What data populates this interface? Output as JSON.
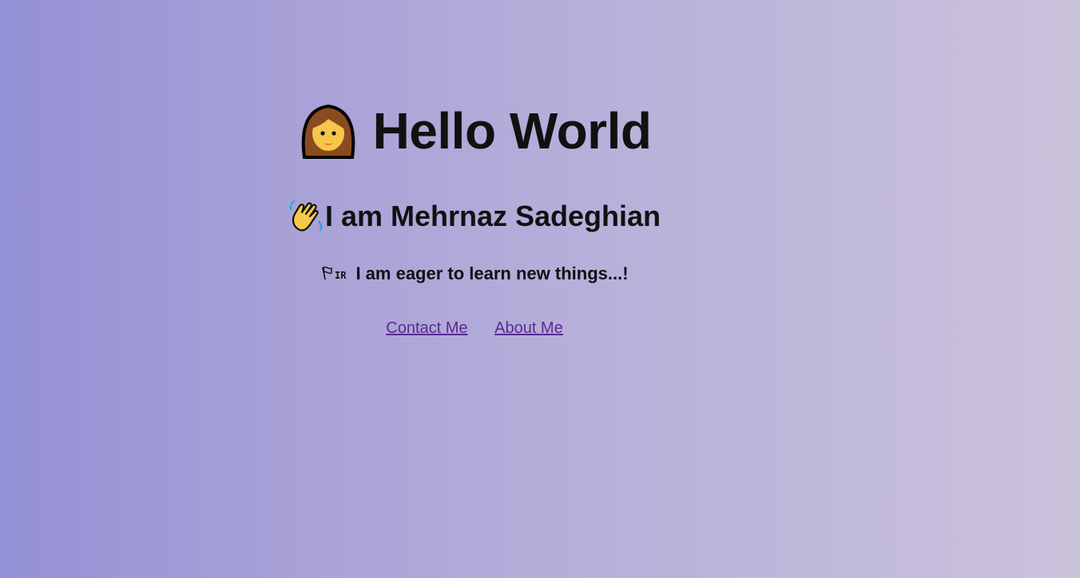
{
  "heading": {
    "emoji": "woman-icon",
    "text": "Hello World"
  },
  "intro": {
    "emoji": "waving-hand-icon",
    "text": "I am Mehrnaz Sadeghian"
  },
  "tagline": {
    "emoji": "flag-iran-icon",
    "emoji_text": "IR",
    "text": "I am eager to learn new things...!"
  },
  "links": [
    {
      "label": "Contact Me"
    },
    {
      "label": "About Me"
    }
  ],
  "colors": {
    "background_start": "#9490d6",
    "background_end": "#cbc2db",
    "text": "#111111",
    "link": "#5b2a8f"
  }
}
